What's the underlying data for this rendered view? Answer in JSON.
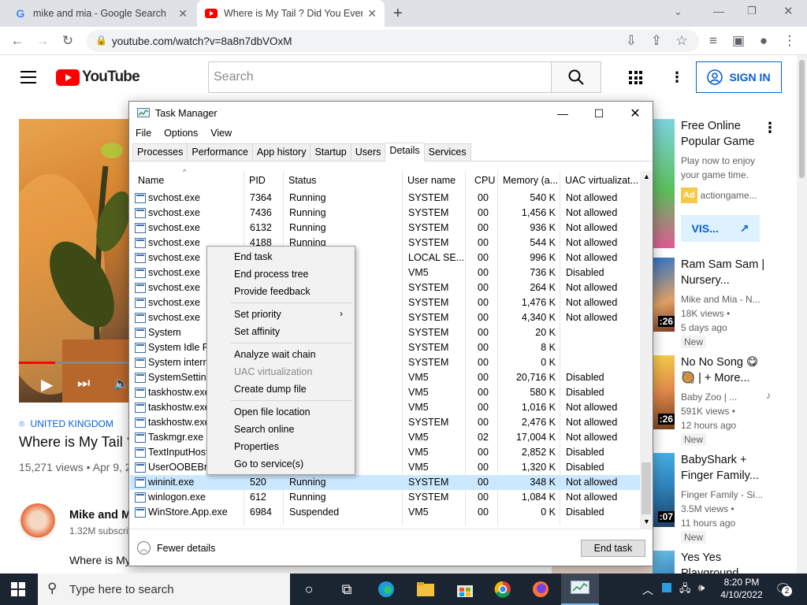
{
  "browser": {
    "tabs": [
      {
        "title": "mike and mia - Google Search"
      },
      {
        "title": "Where is My Tail ? Did You Ever S"
      }
    ],
    "url": "youtube.com/watch?v=8a8n7dbVOxM"
  },
  "youtube": {
    "logo_text": "YouTube",
    "search_placeholder": "Search",
    "signin_label": "SIGN IN",
    "location": "UNITED KINGDOM",
    "video_title": "Where is My Tail ?",
    "views_date": "15,271 views • Apr 9, 2",
    "channel_name": "Mike and Mi",
    "subscribers": "1.32M subscri",
    "description": "Where is My",
    "ad": {
      "title_line1": "Free Online",
      "title_line2": "Popular Game",
      "desc_line1": "Play now to enjoy",
      "desc_line2": "your game time.",
      "ad_badge": "Ad",
      "advertiser": "actiongame...",
      "visit_label": "VIS..."
    },
    "suggestions": [
      {
        "title1": "Ram Sam Sam |",
        "title2": "Nursery...",
        "channel": "Mike and Mia - N...",
        "views": "18K views •",
        "age": "5 days ago",
        "badge": "New",
        "duration": ":26"
      },
      {
        "title1": "No No Song 😋",
        "title2": "🥘 | + More...",
        "channel": "Baby Zoo | ...",
        "views": "591K views •",
        "age": "12 hours ago",
        "badge": "New",
        "duration": ":26"
      },
      {
        "title1": "BabyShark +",
        "title2": "Finger Family...",
        "channel": "Finger Family - Si...",
        "views": "3.5M views •",
        "age": "11 hours ago",
        "badge": "New",
        "duration": ":07"
      },
      {
        "title1": "Yes Yes",
        "title2": "Playground...",
        "channel": "",
        "views": "",
        "age": "",
        "badge": "",
        "duration": ""
      }
    ]
  },
  "task_manager": {
    "title": "Task Manager",
    "menu": [
      "File",
      "Options",
      "View"
    ],
    "tabs": [
      "Processes",
      "Performance",
      "App history",
      "Startup",
      "Users",
      "Details",
      "Services"
    ],
    "active_tab": "Details",
    "columns": [
      "Name",
      "PID",
      "Status",
      "User name",
      "CPU",
      "Memory (a...",
      "UAC virtualizat..."
    ],
    "rows": [
      [
        "svchost.exe",
        "7364",
        "Running",
        "SYSTEM",
        "00",
        "540 K",
        "Not allowed"
      ],
      [
        "svchost.exe",
        "7436",
        "Running",
        "SYSTEM",
        "00",
        "1,456 K",
        "Not allowed"
      ],
      [
        "svchost.exe",
        "6132",
        "Running",
        "SYSTEM",
        "00",
        "936 K",
        "Not allowed"
      ],
      [
        "svchost.exe",
        "4188",
        "Running",
        "SYSTEM",
        "00",
        "544 K",
        "Not allowed"
      ],
      [
        "svchost.exe",
        "",
        "",
        "LOCAL SE...",
        "00",
        "996 K",
        "Not allowed"
      ],
      [
        "svchost.exe",
        "",
        "",
        "VM5",
        "00",
        "736 K",
        "Disabled"
      ],
      [
        "svchost.exe",
        "",
        "",
        "SYSTEM",
        "00",
        "264 K",
        "Not allowed"
      ],
      [
        "svchost.exe",
        "",
        "",
        "SYSTEM",
        "00",
        "1,476 K",
        "Not allowed"
      ],
      [
        "svchost.exe",
        "",
        "",
        "SYSTEM",
        "00",
        "4,340 K",
        "Not allowed"
      ],
      [
        "System",
        "",
        "",
        "SYSTEM",
        "00",
        "20 K",
        ""
      ],
      [
        "System Idle Pr",
        "",
        "",
        "SYSTEM",
        "00",
        "8 K",
        ""
      ],
      [
        "System interru",
        "",
        "",
        "SYSTEM",
        "00",
        "0 K",
        ""
      ],
      [
        "SystemSetting",
        "",
        "",
        "VM5",
        "00",
        "20,716 K",
        "Disabled"
      ],
      [
        "taskhostw.exe",
        "",
        "",
        "VM5",
        "00",
        "580 K",
        "Disabled"
      ],
      [
        "taskhostw.exe",
        "",
        "",
        "VM5",
        "00",
        "1,016 K",
        "Not allowed"
      ],
      [
        "taskhostw.exe",
        "",
        "",
        "SYSTEM",
        "00",
        "2,476 K",
        "Not allowed"
      ],
      [
        "Taskmgr.exe",
        "",
        "",
        "VM5",
        "02",
        "17,004 K",
        "Not allowed"
      ],
      [
        "TextInputHost",
        "",
        "",
        "VM5",
        "00",
        "2,852 K",
        "Disabled"
      ],
      [
        "UserOOBEBrok",
        "",
        "",
        "VM5",
        "00",
        "1,320 K",
        "Disabled"
      ],
      [
        "wininit.exe",
        "520",
        "Running",
        "SYSTEM",
        "00",
        "348 K",
        "Not allowed"
      ],
      [
        "winlogon.exe",
        "612",
        "Running",
        "SYSTEM",
        "00",
        "1,084 K",
        "Not allowed"
      ],
      [
        "WinStore.App.exe",
        "6984",
        "Suspended",
        "VM5",
        "00",
        "0 K",
        "Disabled"
      ]
    ],
    "selected_row": "wininit.exe",
    "fewer_details": "Fewer details",
    "end_task": "End task"
  },
  "context_menu": {
    "items": [
      "End task",
      "End process tree",
      "Provide feedback",
      "Set priority",
      "Set affinity",
      "Analyze wait chain",
      "UAC virtualization",
      "Create dump file",
      "Open file location",
      "Search online",
      "Properties",
      "Go to service(s)"
    ]
  },
  "taskbar": {
    "search_placeholder": "Type here to search",
    "time": "8:20 PM",
    "date": "4/10/2022",
    "notifications": "2"
  }
}
